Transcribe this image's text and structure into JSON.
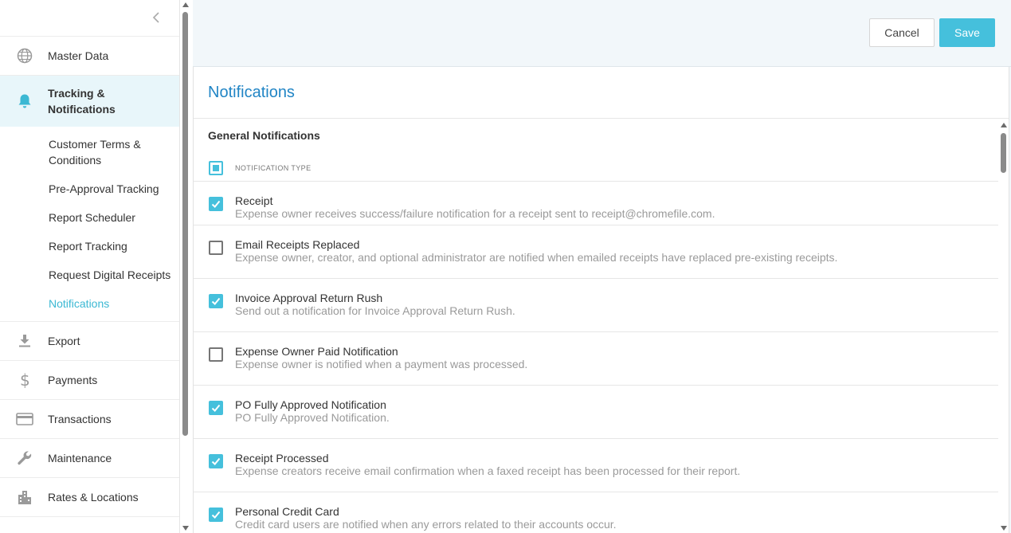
{
  "sidebar": {
    "items": [
      {
        "label": "Master Data",
        "icon": "globe-icon"
      },
      {
        "label": "Tracking & Notifications",
        "icon": "bell-icon"
      },
      {
        "label": "Export",
        "icon": "download-icon"
      },
      {
        "label": "Payments",
        "icon": "dollar-icon"
      },
      {
        "label": "Transactions",
        "icon": "credit-card-icon"
      },
      {
        "label": "Maintenance",
        "icon": "wrench-icon"
      },
      {
        "label": "Rates & Locations",
        "icon": "building-icon"
      }
    ],
    "tracking_label_line1": "Tracking &",
    "tracking_label_line2": "Notifications",
    "sub_items": [
      {
        "label": "Customer Terms & Conditions"
      },
      {
        "label": "Pre-Approval Tracking"
      },
      {
        "label": "Report Scheduler"
      },
      {
        "label": "Report Tracking"
      },
      {
        "label": "Request Digital Receipts"
      },
      {
        "label": "Notifications"
      }
    ]
  },
  "toolbar": {
    "cancel_label": "Cancel",
    "save_label": "Save"
  },
  "page": {
    "title": "Notifications",
    "section_title": "General Notifications",
    "column_header": "NOTIFICATION TYPE"
  },
  "notifications": [
    {
      "name": "Receipt",
      "desc": "Expense owner receives success/failure notification for a receipt sent to receipt@chromefile.com.",
      "checked": true
    },
    {
      "name": "Email Receipts Replaced",
      "desc": "Expense owner, creator, and optional administrator are notified when emailed receipts have replaced pre-existing receipts.",
      "checked": false
    },
    {
      "name": "Invoice Approval Return Rush",
      "desc": "Send out a notification for Invoice Approval Return Rush.",
      "checked": true
    },
    {
      "name": "Expense Owner Paid Notification",
      "desc": "Expense owner is notified when a payment was processed.",
      "checked": false
    },
    {
      "name": "PO Fully Approved Notification",
      "desc": "PO Fully Approved Notification.",
      "checked": true
    },
    {
      "name": "Receipt Processed",
      "desc": "Expense creators receive email confirmation when a faxed receipt has been processed for their report.",
      "checked": true
    },
    {
      "name": "Personal Credit Card",
      "desc": "Credit card users are notified when any errors related to their accounts occur.",
      "checked": true
    }
  ],
  "colors": {
    "accent": "#45c0dc",
    "title_blue": "#2185c5",
    "active_bg": "#e8f6fa"
  }
}
